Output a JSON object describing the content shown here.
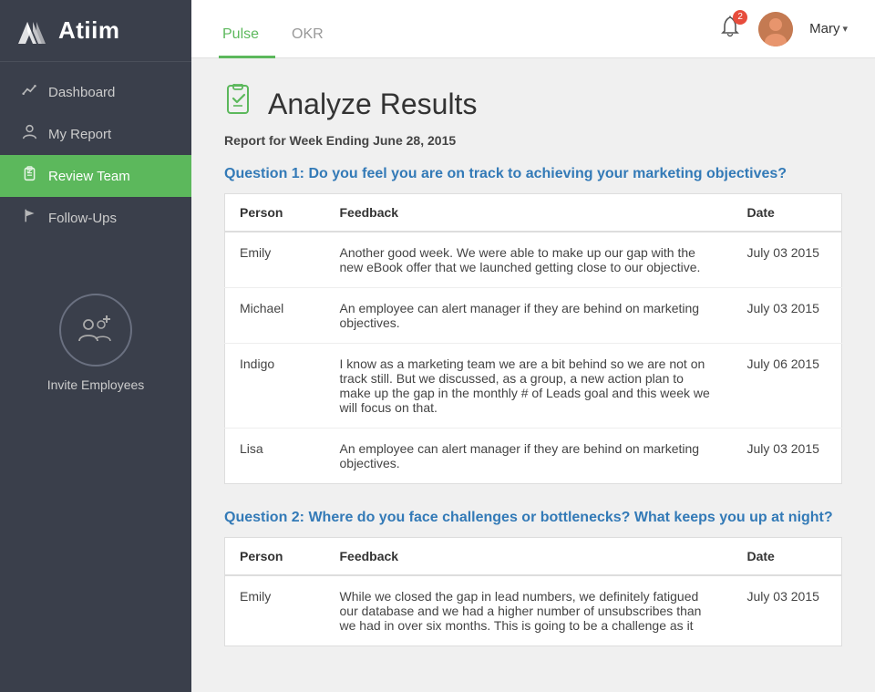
{
  "sidebar": {
    "logo": "Atiim",
    "nav": [
      {
        "id": "dashboard",
        "label": "Dashboard",
        "icon": "chart",
        "active": false
      },
      {
        "id": "my-report",
        "label": "My Report",
        "icon": "person",
        "active": false
      },
      {
        "id": "review-team",
        "label": "Review Team",
        "icon": "clipboard",
        "active": true
      },
      {
        "id": "follow-ups",
        "label": "Follow-Ups",
        "icon": "flag",
        "active": false
      }
    ],
    "invite_label": "Invite Employees"
  },
  "header": {
    "tabs": [
      {
        "id": "pulse",
        "label": "Pulse",
        "active": true
      },
      {
        "id": "okr",
        "label": "OKR",
        "active": false
      }
    ],
    "bell_count": "2",
    "user_name": "Mary",
    "user_dropdown": "▾"
  },
  "page": {
    "title": "Analyze Results",
    "report_date_label": "Report for Week Ending June 28, 2015",
    "questions": [
      {
        "id": "q1",
        "text": "Question 1: Do you feel you are on track to achieving your marketing objectives?",
        "columns": [
          "Person",
          "Feedback",
          "Date"
        ],
        "rows": [
          {
            "person": "Emily",
            "feedback": "Another good week. We were able to make up our gap with the new eBook offer that we launched getting close to our objective.",
            "date": "July 03 2015"
          },
          {
            "person": "Michael",
            "feedback": "An employee can alert manager if they are behind on marketing objectives.",
            "date": "July 03 2015"
          },
          {
            "person": "Indigo",
            "feedback": "I know as a marketing team we are a bit behind so we are not on track still. But we discussed, as a group, a new action plan to make up the gap in the monthly # of Leads goal and this week we will focus on that.",
            "date": "July 06 2015"
          },
          {
            "person": "Lisa",
            "feedback": "An employee can alert manager if they are behind on marketing objectives.",
            "date": "July 03 2015"
          }
        ]
      },
      {
        "id": "q2",
        "text": "Question 2: Where do you face challenges or bottlenecks? What keeps you up at night?",
        "columns": [
          "Person",
          "Feedback",
          "Date"
        ],
        "rows": [
          {
            "person": "Emily",
            "feedback": "While we closed the gap in lead numbers, we definitely fatigued our database and we had a higher number of unsubscribes than we had in over six months. This is going to be a challenge as it",
            "date": "July 03 2015"
          }
        ]
      }
    ]
  }
}
